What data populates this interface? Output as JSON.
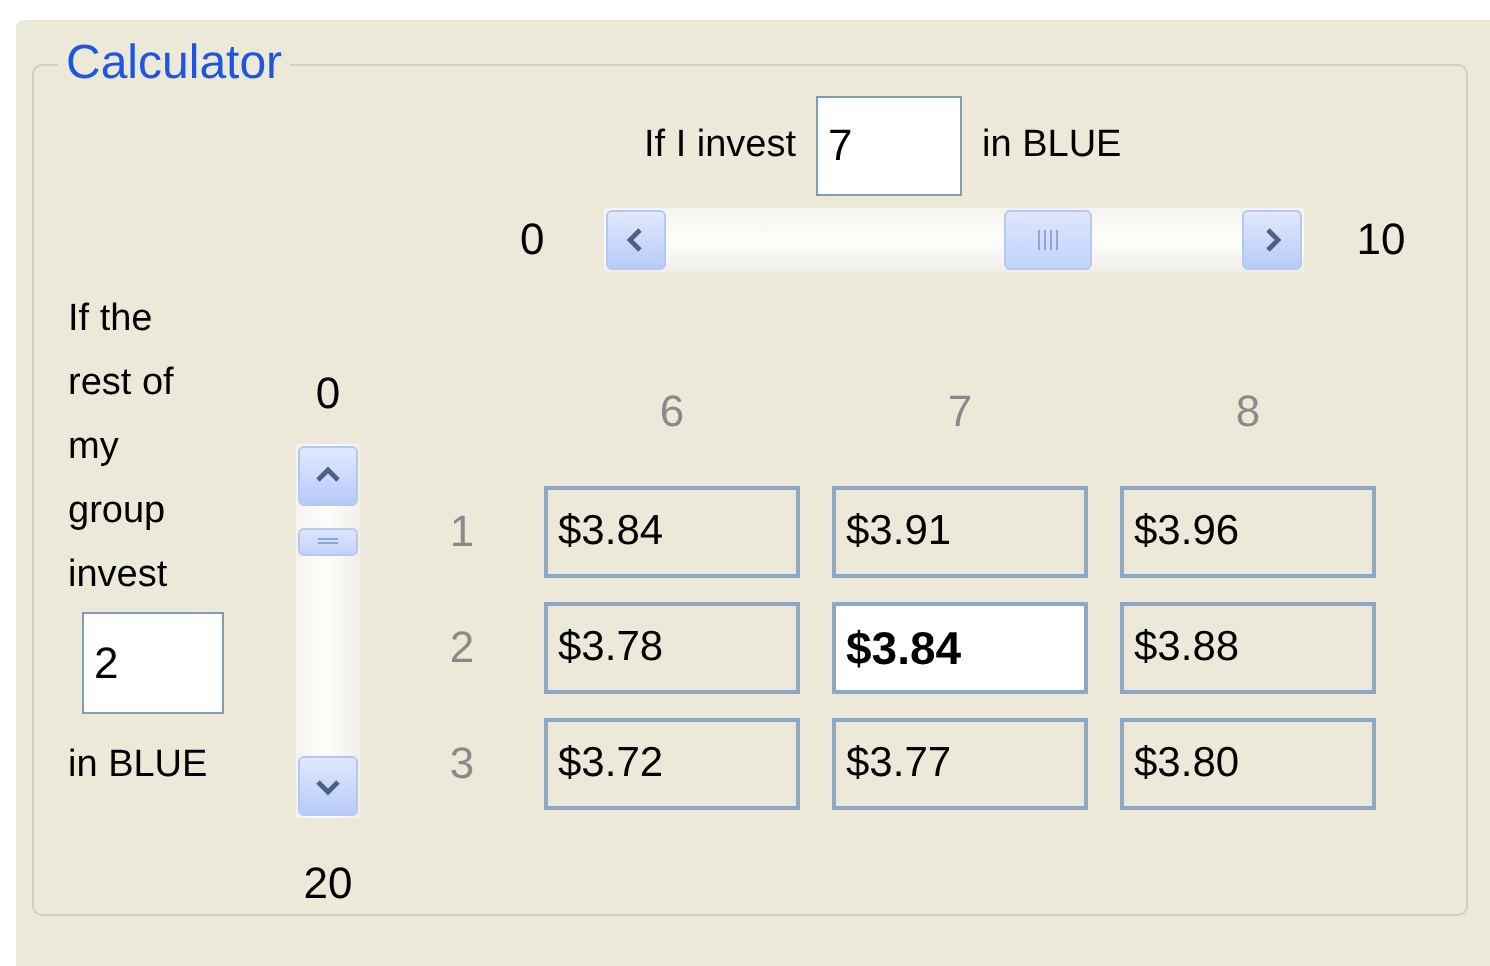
{
  "group": {
    "title": "Calculator"
  },
  "my_invest": {
    "label": "If I invest",
    "value": "7",
    "suffix": "in BLUE"
  },
  "my_scroll": {
    "min": "0",
    "max": "10"
  },
  "group_invest": {
    "label": "If the rest of my group invest",
    "value": "2",
    "suffix": "in BLUE"
  },
  "group_scroll": {
    "min": "0",
    "max": "20"
  },
  "table": {
    "columns": [
      "6",
      "7",
      "8"
    ],
    "rows": [
      {
        "label": "1",
        "cells": [
          {
            "value": "$3.84",
            "selected": false
          },
          {
            "value": "$3.91",
            "selected": false
          },
          {
            "value": "$3.96",
            "selected": false
          }
        ]
      },
      {
        "label": "2",
        "cells": [
          {
            "value": "$3.78",
            "selected": false
          },
          {
            "value": "$3.84",
            "selected": true
          },
          {
            "value": "$3.88",
            "selected": false
          }
        ]
      },
      {
        "label": "3",
        "cells": [
          {
            "value": "$3.72",
            "selected": false
          },
          {
            "value": "$3.77",
            "selected": false
          },
          {
            "value": "$3.80",
            "selected": false
          }
        ]
      }
    ]
  }
}
